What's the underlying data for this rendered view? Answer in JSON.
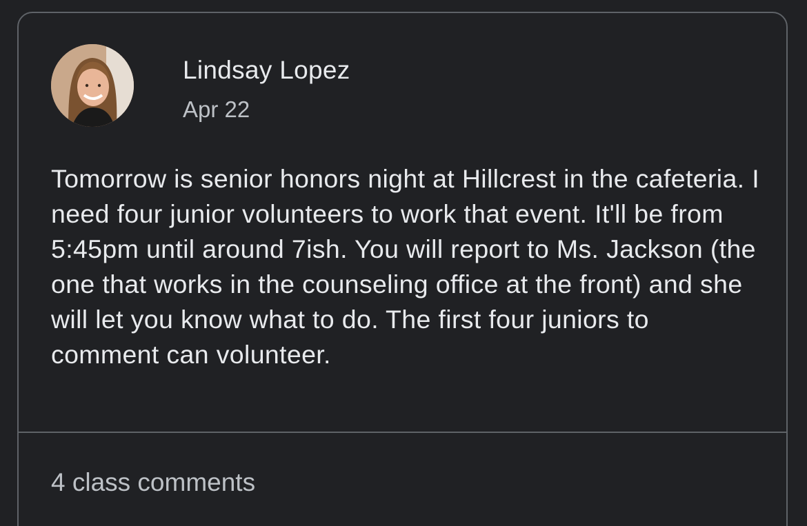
{
  "post": {
    "author": "Lindsay Lopez",
    "date": "Apr 22",
    "body": "Tomorrow is senior honors night at Hillcrest in the cafeteria. I need four junior volunteers to work that event. It'll be from 5:45pm until around 7ish. You will report to Ms. Jackson (the one that works in the counseling office at the front) and she will let you know what to do. The first four juniors to comment can volunteer.",
    "comments_label": "4 class comments"
  },
  "colors": {
    "background": "#202124",
    "border": "#5f6368",
    "primary_text": "#e8eaed",
    "secondary_text": "#bdc1c6"
  }
}
